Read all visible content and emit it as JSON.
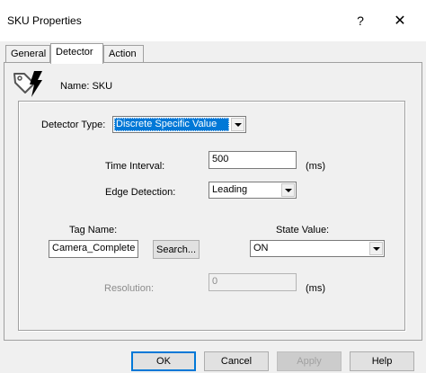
{
  "window": {
    "title": "SKU Properties",
    "help_label": "?",
    "close_label": "✕"
  },
  "tabs": [
    {
      "label": "General",
      "active": false
    },
    {
      "label": "Detector",
      "active": true
    },
    {
      "label": "Action",
      "active": false
    }
  ],
  "header": {
    "icon": "detector-tag-icon",
    "name_label": "Name: SKU"
  },
  "detector": {
    "type_label": "Detector Type:",
    "type_value": "Discrete Specific Value",
    "time_interval_label": "Time Interval:",
    "time_interval_value": "500",
    "time_interval_unit": "(ms)",
    "edge_label": "Edge Detection:",
    "edge_value": "Leading",
    "tag_name_label": "Tag Name:",
    "tag_name_value": "Camera_Complete",
    "search_label": "Search...",
    "state_value_label": "State Value:",
    "state_value": "ON",
    "resolution_label": "Resolution:",
    "resolution_value": "0",
    "resolution_unit": "(ms)"
  },
  "buttons": {
    "ok": "OK",
    "cancel": "Cancel",
    "apply": "Apply",
    "help": "Help"
  },
  "colors": {
    "accent": "#0078d7",
    "disabled_text": "#8c8c8c",
    "background": "#f0f0f0"
  }
}
